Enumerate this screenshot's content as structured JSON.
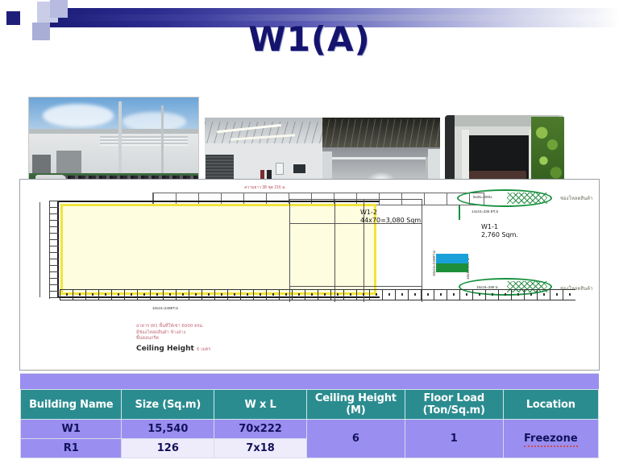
{
  "slide": {
    "title": "W1(A)"
  },
  "photos": [
    {
      "name": "warehouse-exterior-front",
      "caption": ""
    },
    {
      "name": "warehouse-interior-dock-area",
      "caption": ""
    },
    {
      "name": "warehouse-interior-wide",
      "caption": ""
    },
    {
      "name": "warehouse-loading-dock",
      "caption": ""
    }
  ],
  "floorplan": {
    "zone_w1_2": {
      "name": "W1-2",
      "area": "44x70=3,080 Sqm"
    },
    "zone_w1_1": {
      "name": "W1-1",
      "area": "2,760 Sqm."
    },
    "dimension_top": "ความยาว 38 ชุด  216 ม.",
    "dimension_note_1": "8x25=200ม.",
    "dimension_note_2": "14x24=336 ตร.ม",
    "dimension_note_3": "10x24=240ตร.ม",
    "dimension_note_4": "16x18=288 ม.",
    "callout_top": "ช่องโหลดสินค้า",
    "callout_bottom": "ช่องโหลดสินค้า",
    "notes": [
      "อาคาร W1 พื้นที่ให้เช่า 6000 ตรม.",
      "มีช่องโหลดสินค้า ข้างล่าง",
      "พื้นคอนกรีต"
    ],
    "note_bold": "Ceiling Height",
    "note_bold_suffix": "6 เมตร"
  },
  "table": {
    "headers": [
      "Building Name",
      "Size (Sq.m)",
      "W x L",
      "Ceiling Height (M)",
      "Floor Load (Ton/Sq.m)",
      "Location"
    ],
    "headers_split": [
      {
        "l1": "Building Name",
        "l2": ""
      },
      {
        "l1": "Size (Sq.m)",
        "l2": ""
      },
      {
        "l1": "W x L",
        "l2": ""
      },
      {
        "l1": "Ceiling Height",
        "l2": "(M)"
      },
      {
        "l1": "Floor Load",
        "l2": "(Ton/Sq.m)"
      },
      {
        "l1": "Location",
        "l2": ""
      }
    ],
    "rows": [
      {
        "building_name": "W1",
        "size": "15,540",
        "wxl": "70x222"
      },
      {
        "building_name": "R1",
        "size": "126",
        "wxl": "7x18"
      }
    ],
    "merged": {
      "ceiling_height": "6",
      "floor_load": "1",
      "location": "Freezone"
    }
  },
  "colors": {
    "title": "#14146e",
    "header_bar_start": "#1c1c78",
    "table_header_bg": "#2b8c90",
    "table_cell_bg": "#9a8ef0",
    "table_cell_alt_bg": "#eeecfb",
    "table_text": "#12125c",
    "plan_highlight": "#f2e43c",
    "callout_green": "#17913f"
  }
}
